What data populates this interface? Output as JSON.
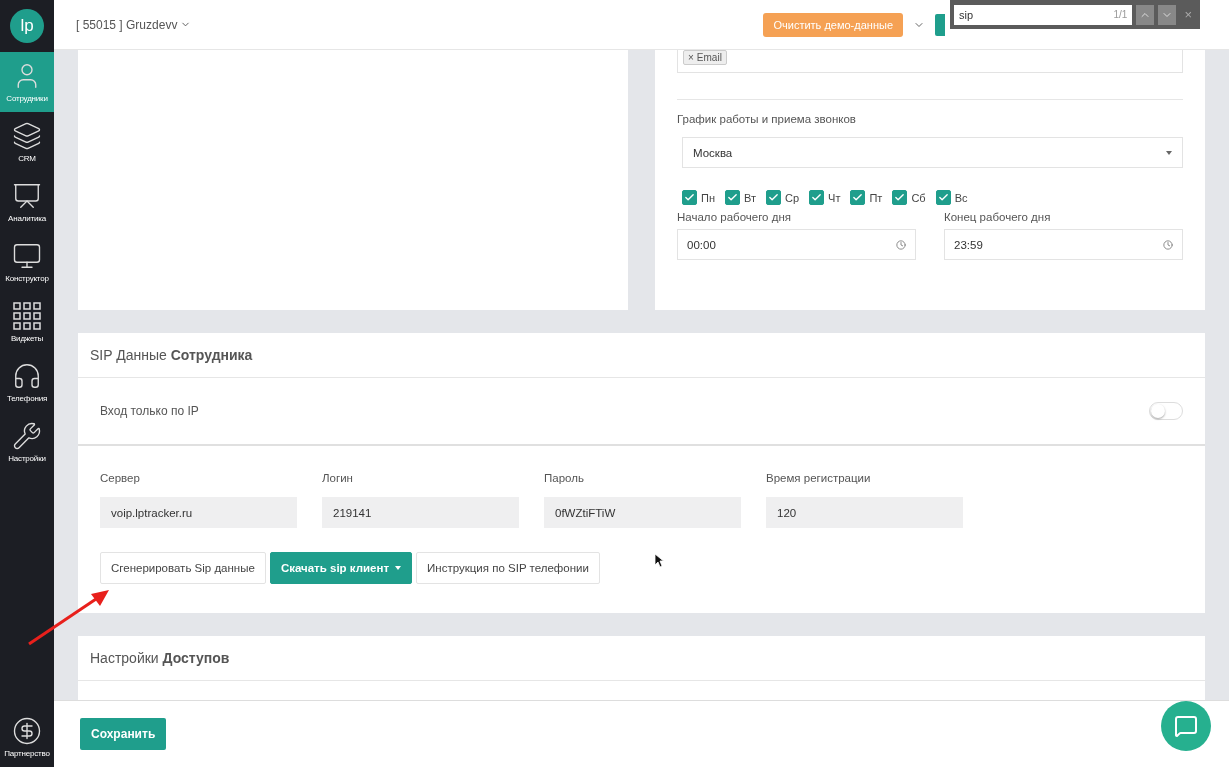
{
  "sidebar": {
    "logo": "lp",
    "items": [
      {
        "label": "Сотрудники",
        "selected": true
      },
      {
        "label": "CRM",
        "selected": false
      },
      {
        "label": "Аналитика",
        "selected": false
      },
      {
        "label": "Конструктор",
        "selected": false
      },
      {
        "label": "Виджеты",
        "selected": false
      },
      {
        "label": "Телефония",
        "selected": false
      },
      {
        "label": "Настройки",
        "selected": false
      }
    ],
    "bottom_item": {
      "label": "Партнерство",
      "selected": false
    }
  },
  "header": {
    "account": "[ 55015 ] Gruzdevv",
    "clear_demo_button": "Очистить демо-данные"
  },
  "find_bar": {
    "query": "sip",
    "count": "1/1",
    "close": "×"
  },
  "schedule_card": {
    "tags": [
      {
        "remove": "×",
        "label": "Email"
      }
    ],
    "schedule_label": "График работы и приема звонков",
    "timezone": "Москва",
    "days": [
      {
        "label": "Пн",
        "checked": true
      },
      {
        "label": "Вт",
        "checked": true
      },
      {
        "label": "Ср",
        "checked": true
      },
      {
        "label": "Чт",
        "checked": true
      },
      {
        "label": "Пт",
        "checked": true
      },
      {
        "label": "Сб",
        "checked": true
      },
      {
        "label": "Вс",
        "checked": true
      }
    ],
    "start": {
      "label": "Начало рабочего дня",
      "value": "00:00"
    },
    "end": {
      "label": "Конец рабочего дня",
      "value": "23:59"
    }
  },
  "sip_card": {
    "title": "SIP Данные **Сотрудника**",
    "ip_only": {
      "label": "Вход только по IP",
      "on": false
    },
    "fields": [
      {
        "label": "Сервер",
        "value": "voip.lptracker.ru"
      },
      {
        "label": "Логин",
        "value": "219141"
      },
      {
        "label": "Пароль",
        "value": "0fWZtiFTiW"
      },
      {
        "label": "Время регистрации",
        "value": "120"
      }
    ],
    "buttons": [
      {
        "label": "Сгенерировать Sip данные",
        "kind": "default"
      },
      {
        "label": "Скачать sip клиент",
        "kind": "dropdown"
      },
      {
        "label": "Инструкция по SIP телефонии",
        "kind": "default"
      }
    ]
  },
  "access_card": {
    "title": "Настройки **Доступов**"
  },
  "footer": {
    "save_button": "Сохранить"
  }
}
